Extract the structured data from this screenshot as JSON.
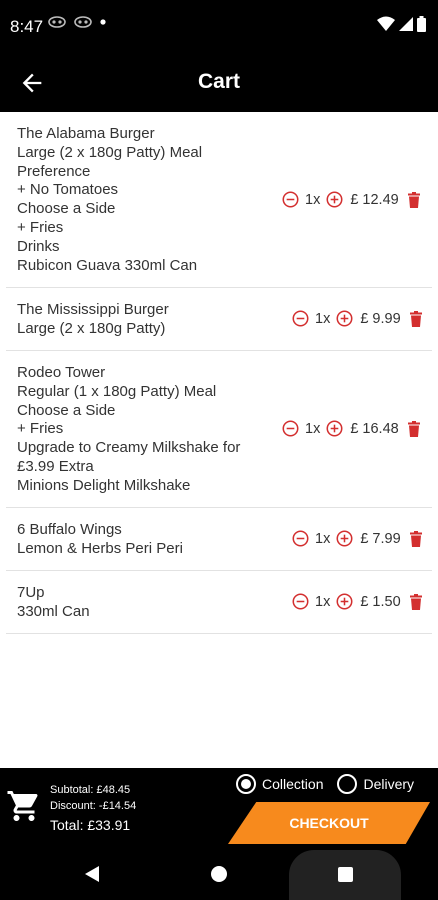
{
  "status": {
    "time": "8:47"
  },
  "header": {
    "title": "Cart"
  },
  "items": [
    {
      "lines": [
        "The Alabama Burger",
        "Large (2 x 180g Patty) Meal",
        "Preference",
        "+ No Tomatoes",
        "Choose a Side",
        "+ Fries",
        "Drinks",
        "Rubicon Guava 330ml Can"
      ],
      "qty": "1x",
      "price": "£ 12.49"
    },
    {
      "lines": [
        "The Mississippi Burger",
        "Large (2 x 180g Patty)"
      ],
      "qty": "1x",
      "price": "£ 9.99"
    },
    {
      "lines": [
        "Rodeo Tower",
        "Regular (1 x 180g Patty) Meal",
        "Choose a Side",
        "+ Fries",
        "Upgrade to Creamy Milkshake for",
        "£3.99 Extra",
        "Minions Delight Milkshake"
      ],
      "qty": "1x",
      "price": "£ 16.48"
    },
    {
      "lines": [
        "6 Buffalo Wings",
        "Lemon & Herbs Peri Peri"
      ],
      "qty": "1x",
      "price": "£ 7.99"
    },
    {
      "lines": [
        "7Up",
        "330ml Can"
      ],
      "qty": "1x",
      "price": "£ 1.50"
    }
  ],
  "summary": {
    "subtotal": "Subtotal: £48.45",
    "discount": "Discount: -£14.54",
    "total": "Total: £33.91"
  },
  "order_type": {
    "collection_label": "Collection",
    "delivery_label": "Delivery",
    "selected": "Collection"
  },
  "checkout_label": "CHECKOUT",
  "colors": {
    "accent": "#f78a1d",
    "icon_red": "#d32f2f",
    "bar": "#000000"
  },
  "icons": {
    "back": "arrow-left-icon",
    "minus": "minus-circle-icon",
    "plus": "plus-circle-icon",
    "delete": "trash-icon",
    "cart": "shopping-cart-icon"
  }
}
